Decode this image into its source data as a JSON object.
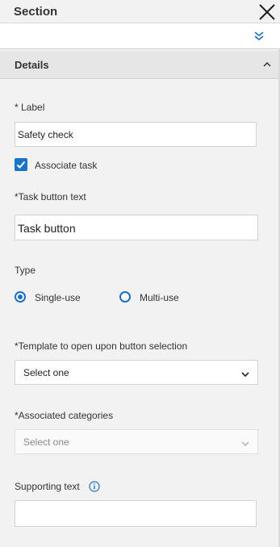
{
  "header": {
    "title": "Section"
  },
  "details": {
    "title": "Details"
  },
  "form": {
    "label_label": "* Label",
    "label_value": "Safety check",
    "associate_task_label": "Associate task",
    "associate_task_checked": true,
    "task_button_label": "*Task button text",
    "task_button_value": "Task button",
    "type_label": "Type",
    "type_options": [
      "Single-use",
      "Multi-use"
    ],
    "type_selected": "Single-use",
    "template_label": "*Template to open upon button selection",
    "template_value": "Select one",
    "categories_label": "*Associated categories",
    "categories_value": "Select one",
    "supporting_text_label": "Supporting text",
    "supporting_text_value": ""
  },
  "icons": {
    "close": "close-icon",
    "expand": "double-chevron-down-icon",
    "collapse": "chevron-up-icon",
    "info": "info-icon"
  },
  "colors": {
    "accent": "#1a6fc4"
  }
}
